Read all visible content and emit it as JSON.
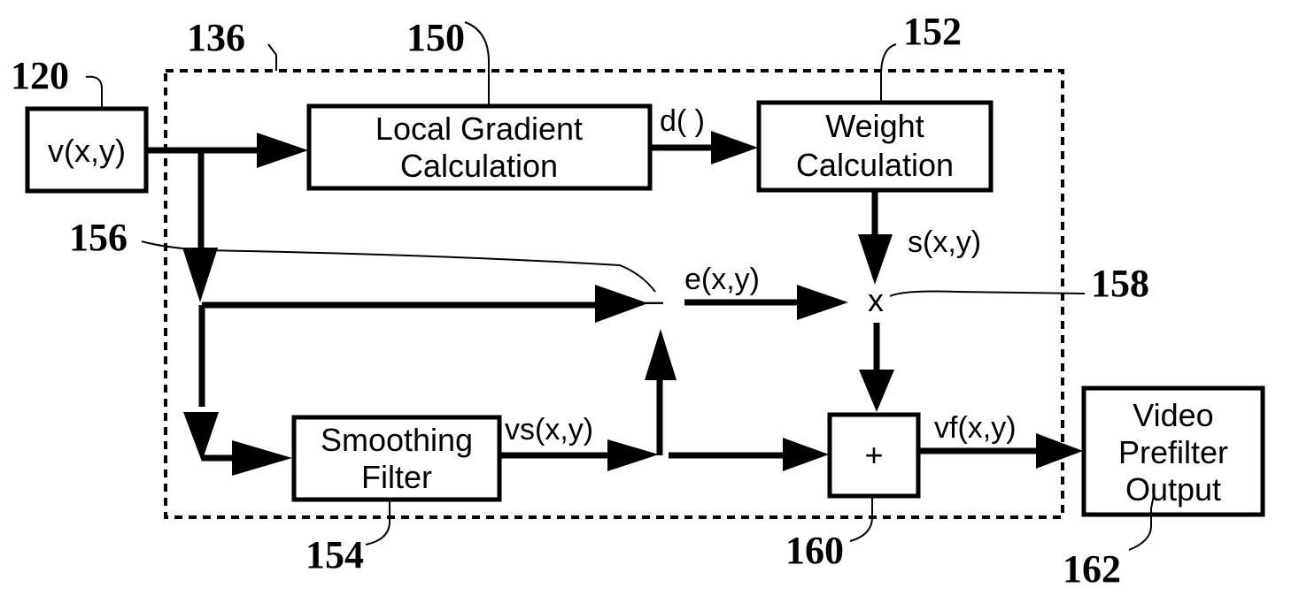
{
  "diagram": {
    "type": "signal-flow block diagram",
    "colors": {
      "ink": "#000000",
      "background": "#ffffff"
    },
    "enclosure": {
      "ref": "136",
      "style": "dashed"
    },
    "blocks": {
      "input": {
        "ref": "120",
        "lines": [
          "v(x,y)"
        ]
      },
      "gradient": {
        "ref": "150",
        "lines": [
          "Local Gradient",
          "Calculation"
        ]
      },
      "weight": {
        "ref": "152",
        "lines": [
          "Weight",
          "Calculation"
        ]
      },
      "smoothing": {
        "ref": "154",
        "lines": [
          "Smoothing",
          "Filter"
        ]
      },
      "adder": {
        "ref": "160",
        "symbol": "+"
      },
      "output": {
        "ref": "162",
        "lines": [
          "Video",
          "Prefilter",
          "Output"
        ]
      }
    },
    "nodes": {
      "subtractor": {
        "ref": "156",
        "symbol": "–"
      },
      "multiplier": {
        "ref": "158",
        "symbol": "x"
      }
    },
    "signals": {
      "d": "d( )",
      "s": "s(x,y)",
      "e": "e(x,y)",
      "vs": "vs(x,y)",
      "vf": "vf(x,y)"
    },
    "connections": [
      {
        "from": "input",
        "to": "gradient"
      },
      {
        "from": "gradient",
        "to": "weight",
        "label": "d( )"
      },
      {
        "from": "weight",
        "to": "multiplier",
        "label": "s(x,y)"
      },
      {
        "from": "input",
        "to": "subtractor"
      },
      {
        "from": "input",
        "to": "smoothing"
      },
      {
        "from": "smoothing",
        "to": "subtractor",
        "label": "vs(x,y)"
      },
      {
        "from": "smoothing",
        "to": "adder",
        "label": "vs(x,y)"
      },
      {
        "from": "subtractor",
        "to": "multiplier",
        "label": "e(x,y)"
      },
      {
        "from": "multiplier",
        "to": "adder"
      },
      {
        "from": "adder",
        "to": "output",
        "label": "vf(x,y)"
      }
    ]
  }
}
